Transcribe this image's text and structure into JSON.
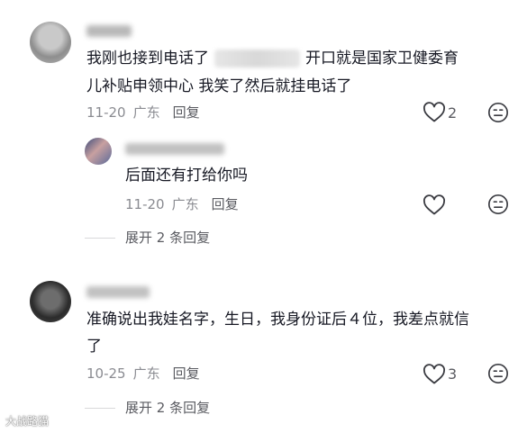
{
  "comments": [
    {
      "text_before": "我刚也接到电话了",
      "text_after": "开口就是国家卫健委育",
      "text_line2": "儿补贴申领中心 我笑了然后就挂电话了",
      "date": "11-20",
      "location": "广东",
      "reply_label": "回复",
      "like_count": "2",
      "replies": [
        {
          "text": "后面还有打给你吗",
          "date": "11-20",
          "location": "广东",
          "reply_label": "回复"
        }
      ],
      "expand_label": "展开 2 条回复"
    },
    {
      "text_line1": "准确说出我娃名字，生日，我身份证后４位，我差点就信",
      "text_line2": "了",
      "date": "10-25",
      "location": "广东",
      "reply_label": "回复",
      "like_count": "3",
      "expand_label": "展开 2 条回复"
    }
  ],
  "icons": {
    "like": "heart-outline-icon",
    "dislike": "neutral-face-icon"
  },
  "watermark": "大战路猫"
}
